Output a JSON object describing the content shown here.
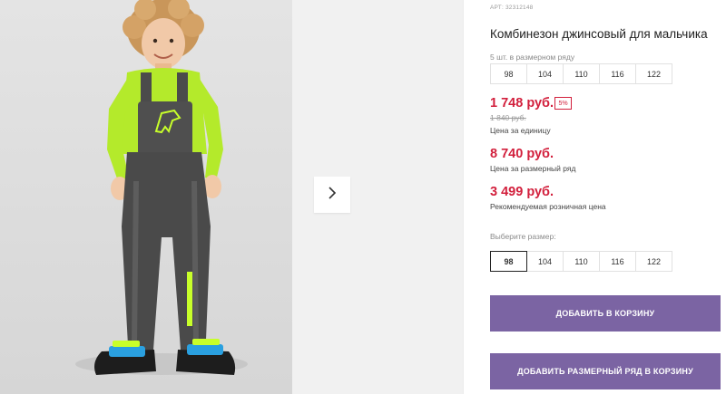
{
  "product": {
    "article": "АРТ: 32312148",
    "title": "Комбинезон джинсовый для мальчика"
  },
  "size_range": {
    "label": "5 шт. в размерном ряду",
    "sizes": [
      "98",
      "104",
      "110",
      "116",
      "122"
    ]
  },
  "pricing": {
    "unit_price": "1 748 руб.",
    "discount": "5%",
    "old_price": "1 840 руб.",
    "unit_caption": "Цена за единицу",
    "range_price": "8 740 руб.",
    "range_caption": "Цена за размерный ряд",
    "retail_price": "3 499 руб.",
    "retail_caption": "Рекомендуемая розничная цена",
    "price_color": "#d21f3c"
  },
  "size_picker": {
    "label": "Выберите размер:",
    "sizes": [
      "98",
      "104",
      "110",
      "116",
      "122"
    ],
    "selected": "98"
  },
  "actions": {
    "add_to_cart": "ДОБАВИТЬ В КОРЗИНУ",
    "add_range_to_cart": "ДОБАВИТЬ РАЗМЕРНЫЙ РЯД В КОРЗИНУ",
    "button_color": "#7b64a3"
  },
  "gallery": {
    "next_icon": "chevron-right-icon"
  }
}
